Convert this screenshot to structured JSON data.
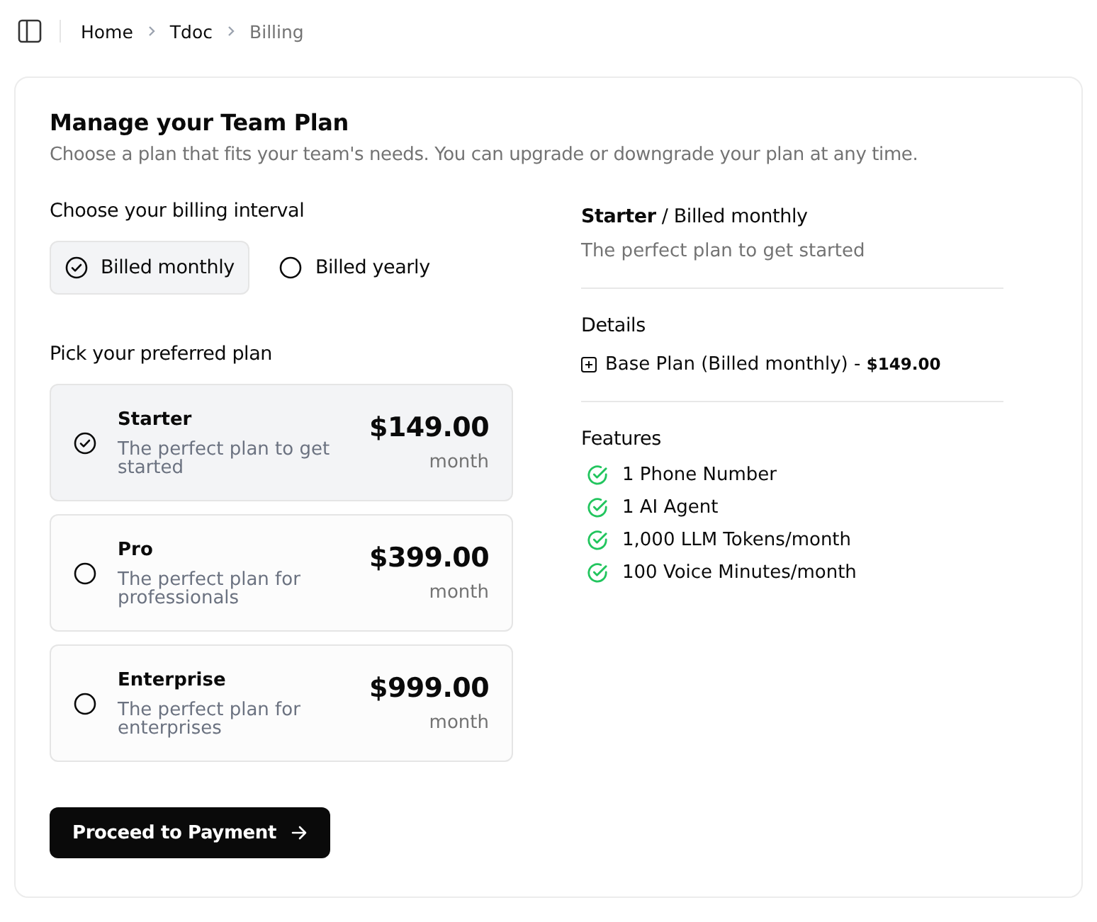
{
  "breadcrumb": [
    {
      "label": "Home",
      "current": false
    },
    {
      "label": "Tdoc",
      "current": false
    },
    {
      "label": "Billing",
      "current": true
    }
  ],
  "title": "Manage your Team Plan",
  "subtitle": "Choose a plan that fits your team's needs. You can upgrade or downgrade your plan at any time.",
  "interval_heading": "Choose your billing interval",
  "intervals": [
    {
      "label": "Billed monthly",
      "selected": true
    },
    {
      "label": "Billed yearly",
      "selected": false
    }
  ],
  "plan_heading": "Pick your preferred plan",
  "plans": [
    {
      "name": "Starter",
      "description": "The perfect plan to get started",
      "price": "$149.00",
      "period": "month",
      "selected": true
    },
    {
      "name": "Pro",
      "description": "The perfect plan for professionals",
      "price": "$399.00",
      "period": "month",
      "selected": false
    },
    {
      "name": "Enterprise",
      "description": "The perfect plan for enterprises",
      "price": "$999.00",
      "period": "month",
      "selected": false
    }
  ],
  "proceed_button": "Proceed to Payment",
  "summary": {
    "title": "**Starter** / Billed monthly",
    "description": "The perfect plan to get started"
  },
  "details": {
    "heading": "Details",
    "line": "Base Plan (Billed monthly) - **$149.00**"
  },
  "features": {
    "heading": "Features",
    "items": [
      "1 Phone Number",
      "1 AI Agent",
      "1,000 LLM Tokens/month",
      "100 Voice Minutes/month"
    ]
  }
}
